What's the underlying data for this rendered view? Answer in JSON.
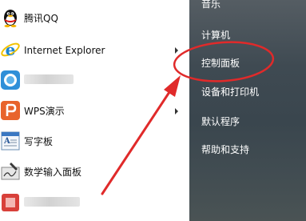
{
  "start_menu": {
    "programs": [
      {
        "label": "腾讯QQ"
      },
      {
        "label": "Internet Explorer"
      },
      {
        "label": ""
      },
      {
        "label": "WPS演示"
      },
      {
        "label": "写字板"
      },
      {
        "label": "数学输入面板"
      },
      {
        "label": ""
      }
    ],
    "right_items": [
      {
        "label": "音乐"
      },
      {
        "label": "计算机"
      },
      {
        "label": "控制面板"
      },
      {
        "label": "设备和打印机"
      },
      {
        "label": "默认程序"
      },
      {
        "label": "帮助和支持"
      }
    ]
  },
  "icons": [
    "qq-penguin-icon",
    "internet-explorer-icon",
    "blurred-app-icon",
    "wps-presentation-icon",
    "wordpad-icon",
    "math-input-panel-icon",
    "blurred-app-icon"
  ],
  "colors": {
    "annotation_red": "#e02a2a",
    "right_panel": "#3f4a52",
    "right_text": "#ffffff",
    "wps_orange": "#e8642c",
    "ie_blue": "#1e86d0"
  }
}
